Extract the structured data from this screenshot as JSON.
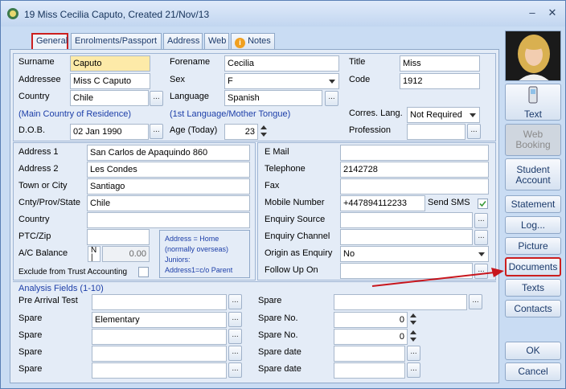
{
  "window": {
    "title": "19 Miss Cecilia Caputo,  Created 21/Nov/13",
    "minimize": "–",
    "close": "✕"
  },
  "tabs": [
    {
      "label": "General"
    },
    {
      "label": "Enrolments/Passport"
    },
    {
      "label": "Address"
    },
    {
      "label": "Web"
    },
    {
      "label": "Notes"
    }
  ],
  "personal": {
    "surname_label": "Surname",
    "surname": "Caputo",
    "forename_label": "Forename",
    "forename": "Cecilia",
    "title_label": "Title",
    "title": "Miss",
    "addressee_label": "Addressee",
    "addressee": "Miss C Caputo",
    "sex_label": "Sex",
    "sex": "F",
    "code_label": "Code",
    "code": "1912",
    "country_label": "Country",
    "country": "Chile",
    "language_label": "Language",
    "language": "Spanish",
    "corres_lang_label": "Corres. Lang.",
    "corres_lang": "Not Required",
    "main_country_note": "(Main Country of Residence)",
    "language_note": "(1st Language/Mother Tongue)",
    "dob_label": "D.O.B.",
    "dob": "02 Jan 1990",
    "age_label": "Age (Today)",
    "age": "23",
    "profession_label": "Profession",
    "profession": ""
  },
  "address": {
    "address1_label": "Address 1",
    "address1": "San Carlos de Apaquindo 860",
    "address2_label": "Address 2",
    "address2": "Les Condes",
    "town_label": "Town or City",
    "town": "Santiago",
    "county_label": "Cnty/Prov/State",
    "county": "Chile",
    "country_label": "Country",
    "country": "",
    "ptc_label": "PTC/Zip",
    "ptc": "",
    "balance_label": "A/C Balance",
    "balance_mark": "N\n|",
    "balance": "0.00",
    "exclude_label": "Exclude from Trust Accounting",
    "note_lines": [
      "Address = Home",
      "(normally overseas)",
      "Juniors:",
      "Address1=c/o Parent"
    ]
  },
  "contact": {
    "email_label": "E Mail",
    "email": "",
    "telephone_label": "Telephone",
    "telephone": "2142728",
    "fax_label": "Fax",
    "fax": "",
    "mobile_label": "Mobile Number",
    "mobile": "+447894112233",
    "send_sms_label": "Send SMS",
    "enquiry_source_label": "Enquiry Source",
    "enquiry_source": "",
    "enquiry_channel_label": "Enquiry Channel",
    "enquiry_channel": "",
    "origin_label": "Origin as Enquiry",
    "origin": "No",
    "follow_up_label": "Follow Up On",
    "follow_up": ""
  },
  "analysis": {
    "header": "Analysis Fields (1-10)",
    "left": [
      {
        "label": "Pre Arrival Test",
        "value": ""
      },
      {
        "label": "Spare",
        "value": "Elementary"
      },
      {
        "label": "Spare",
        "value": ""
      },
      {
        "label": "Spare",
        "value": ""
      },
      {
        "label": "Spare",
        "value": ""
      }
    ],
    "right": [
      {
        "label": "Spare",
        "value": ""
      },
      {
        "label": "Spare No.",
        "value": "0"
      },
      {
        "label": "Spare No.",
        "value": "0"
      },
      {
        "label": "Spare date",
        "value": ""
      },
      {
        "label": "Spare date",
        "value": ""
      }
    ]
  },
  "sidebar": {
    "text": "Text",
    "web_booking": "Web Booking",
    "student_account": "Student Account",
    "statement": "Statement",
    "log": "Log...",
    "picture": "Picture",
    "documents": "Documents",
    "texts": "Texts",
    "contacts": "Contacts",
    "ok": "OK",
    "cancel": "Cancel"
  },
  "ellipsis": "..."
}
